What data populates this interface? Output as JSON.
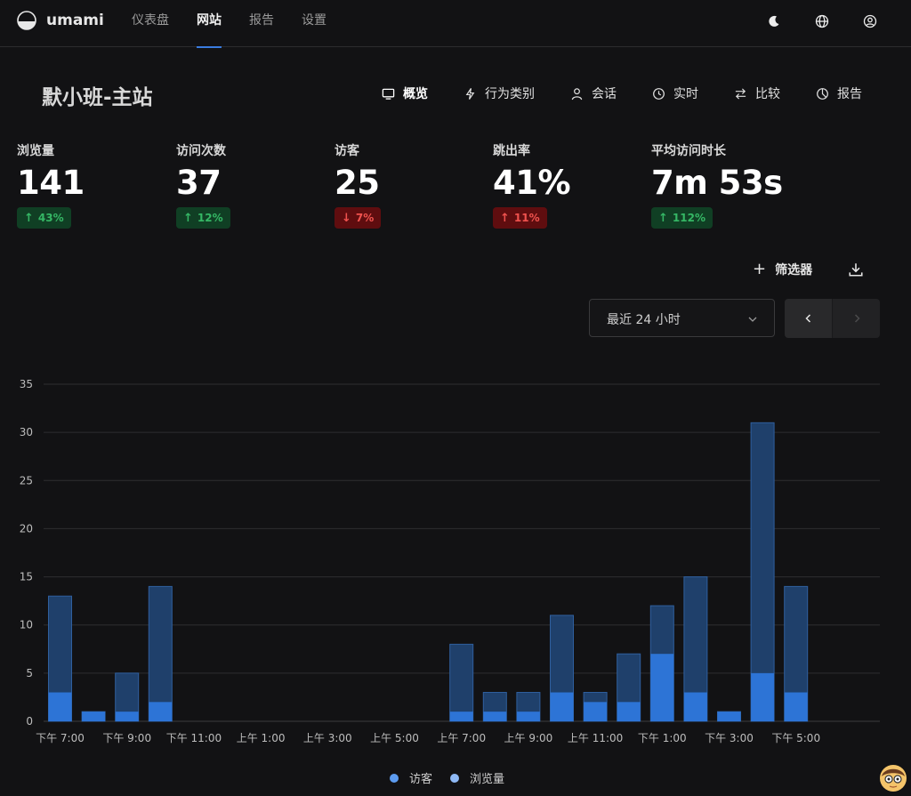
{
  "app": {
    "name": "umami"
  },
  "nav": [
    {
      "label": "仪表盘",
      "active": false
    },
    {
      "label": "网站",
      "active": true
    },
    {
      "label": "报告",
      "active": false
    },
    {
      "label": "设置",
      "active": false
    }
  ],
  "top_icons": [
    "moon-icon",
    "globe-icon",
    "user-icon"
  ],
  "site": {
    "title": "默小班-主站"
  },
  "tabs": [
    {
      "label": "概览",
      "icon": "monitor-icon",
      "active": true
    },
    {
      "label": "行为类别",
      "icon": "bolt-icon",
      "active": false
    },
    {
      "label": "会话",
      "icon": "user-icon",
      "active": false
    },
    {
      "label": "实时",
      "icon": "clock-icon",
      "active": false
    },
    {
      "label": "比较",
      "icon": "swap-icon",
      "active": false
    },
    {
      "label": "报告",
      "icon": "pie-icon",
      "active": false
    }
  ],
  "metrics": [
    {
      "label": "浏览量",
      "value": "141",
      "change": "43%",
      "direction": "up"
    },
    {
      "label": "访问次数",
      "value": "37",
      "change": "12%",
      "direction": "up"
    },
    {
      "label": "访客",
      "value": "25",
      "change": "7%",
      "direction": "down"
    },
    {
      "label": "跳出率",
      "value": "41%",
      "change": "11%",
      "direction": "up-bad"
    },
    {
      "label": "平均访问时长",
      "value": "7m 53s",
      "change": "112%",
      "direction": "up"
    }
  ],
  "controls": {
    "filter_label": "筛选器",
    "date_range": "最近 24 小时"
  },
  "colors": {
    "visitors": "#2d74d6",
    "pageviews": "#1f406b",
    "accent": "#3a7ce0",
    "up_bg": "#103f24",
    "up_text": "#35b765",
    "down_bg": "#5f0d0f",
    "down_text": "#f0524e"
  },
  "chart_data": {
    "type": "bar",
    "stacked_overlay": true,
    "x_tick_labels": [
      "下午 7:00",
      "下午 9:00",
      "下午 11:00",
      "上午 1:00",
      "上午 3:00",
      "上午 5:00",
      "上午 7:00",
      "上午 9:00",
      "上午 11:00",
      "下午 1:00",
      "下午 3:00",
      "下午 5:00"
    ],
    "ylim": [
      0,
      35
    ],
    "yticks": [
      0,
      5,
      10,
      15,
      20,
      25,
      30,
      35
    ],
    "grid": true,
    "legend_position": "bottom",
    "series": [
      {
        "name": "访客",
        "color": "#2d74d6",
        "values": [
          3,
          1,
          1,
          2,
          0,
          0,
          0,
          0,
          0,
          0,
          0,
          0,
          1,
          1,
          1,
          3,
          2,
          2,
          7,
          3,
          1,
          5,
          3
        ]
      },
      {
        "name": "浏览量",
        "color": "#1f406b",
        "values": [
          13,
          1,
          5,
          14,
          0,
          0,
          0,
          0,
          0,
          0,
          0,
          0,
          8,
          3,
          3,
          11,
          3,
          7,
          12,
          15,
          1,
          31,
          14
        ]
      }
    ]
  }
}
